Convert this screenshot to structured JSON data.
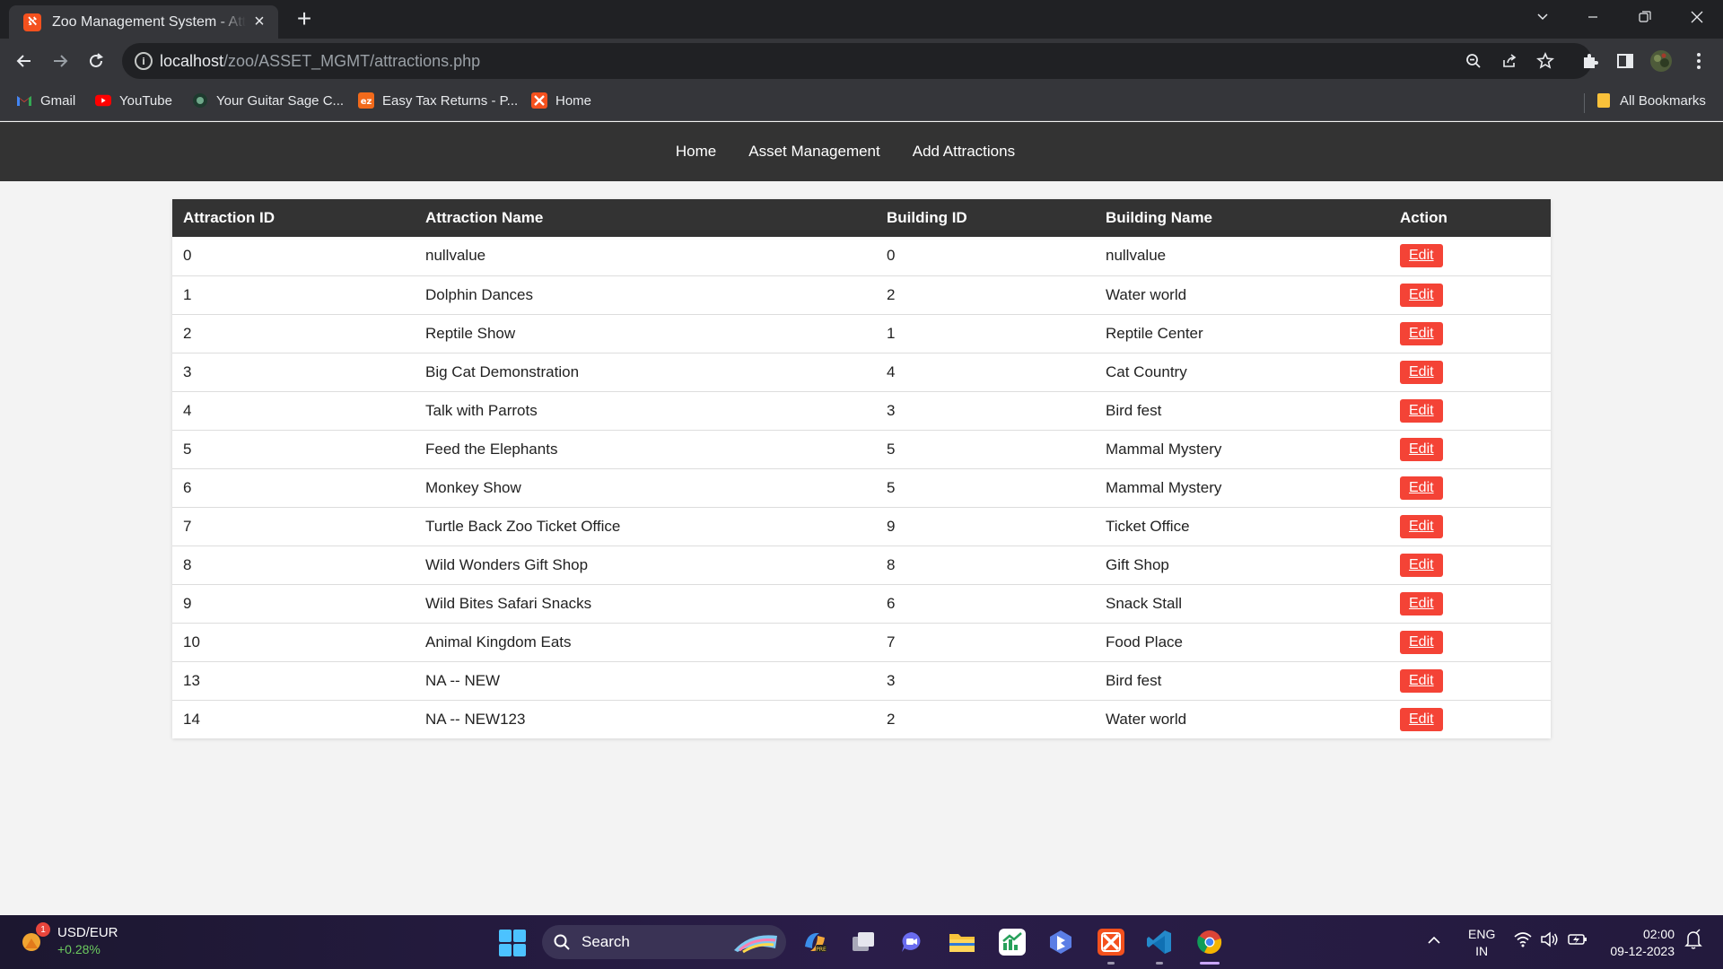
{
  "browser": {
    "tab_title": "Zoo Management System - Attractions",
    "url_host": "localhost",
    "url_path": "/zoo/ASSET_MGMT/attractions.php",
    "bookmarks": [
      {
        "label": "Gmail",
        "icon": "gmail-icon"
      },
      {
        "label": "YouTube",
        "icon": "youtube-icon"
      },
      {
        "label": "Your Guitar Sage C...",
        "icon": "guitar-sage-icon"
      },
      {
        "label": "Easy Tax Returns - P...",
        "icon": "easy-tax-icon"
      },
      {
        "label": "Home",
        "icon": "zoo-home-icon"
      }
    ],
    "all_bookmarks": "All Bookmarks"
  },
  "nav": {
    "items": [
      "Home",
      "Asset Management",
      "Add Attractions"
    ]
  },
  "table": {
    "headers": [
      "Attraction ID",
      "Attraction Name",
      "Building ID",
      "Building Name",
      "Action"
    ],
    "edit_label": "Edit",
    "rows": [
      {
        "id": "0",
        "name": "nullvalue",
        "building_id": "0",
        "building_name": "nullvalue"
      },
      {
        "id": "1",
        "name": "Dolphin Dances",
        "building_id": "2",
        "building_name": "Water world"
      },
      {
        "id": "2",
        "name": "Reptile Show",
        "building_id": "1",
        "building_name": "Reptile Center"
      },
      {
        "id": "3",
        "name": "Big Cat Demonstration",
        "building_id": "4",
        "building_name": "Cat Country"
      },
      {
        "id": "4",
        "name": "Talk with Parrots",
        "building_id": "3",
        "building_name": "Bird fest"
      },
      {
        "id": "5",
        "name": "Feed the Elephants",
        "building_id": "5",
        "building_name": "Mammal Mystery"
      },
      {
        "id": "6",
        "name": "Monkey Show",
        "building_id": "5",
        "building_name": "Mammal Mystery"
      },
      {
        "id": "7",
        "name": "Turtle Back Zoo Ticket Office",
        "building_id": "9",
        "building_name": "Ticket Office"
      },
      {
        "id": "8",
        "name": "Wild Wonders Gift Shop",
        "building_id": "8",
        "building_name": "Gift Shop"
      },
      {
        "id": "9",
        "name": "Wild Bites Safari Snacks",
        "building_id": "6",
        "building_name": "Snack Stall"
      },
      {
        "id": "10",
        "name": "Animal Kingdom Eats",
        "building_id": "7",
        "building_name": "Food Place"
      },
      {
        "id": "13",
        "name": "NA -- NEW",
        "building_id": "3",
        "building_name": "Bird fest"
      },
      {
        "id": "14",
        "name": "NA -- NEW123",
        "building_id": "2",
        "building_name": "Water world"
      }
    ]
  },
  "taskbar": {
    "widget_title": "USD/EUR",
    "widget_value": "+0.28%",
    "widget_badge": "1",
    "search_label": "Search",
    "lang_line1": "ENG",
    "lang_line2": "IN",
    "time": "02:00",
    "date": "09-12-2023"
  },
  "colors": {
    "nav_bg": "#333333",
    "edit_button": "#f44336",
    "page_bg": "#f3f3f3"
  }
}
